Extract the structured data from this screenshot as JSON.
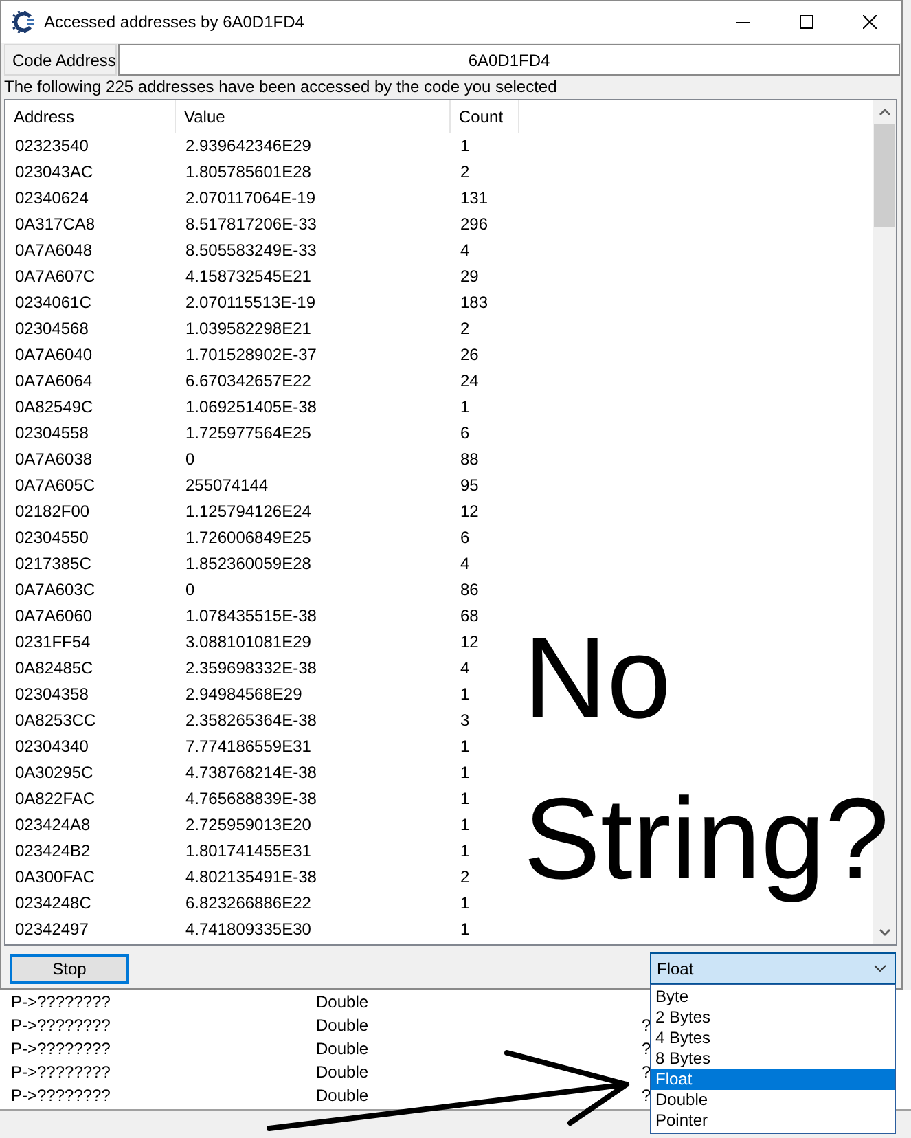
{
  "window": {
    "title": "Accessed addresses by 6A0D1FD4"
  },
  "code_address": {
    "label": "Code Address",
    "value": "6A0D1FD4"
  },
  "info_text": "The following 225 addresses have been accessed by the code you selected",
  "table": {
    "columns": [
      "Address",
      "Value",
      "Count"
    ],
    "rows": [
      [
        "02323540",
        "2.939642346E29",
        "1"
      ],
      [
        "023043AC",
        "1.805785601E28",
        "2"
      ],
      [
        "02340624",
        "2.070117064E-19",
        "131"
      ],
      [
        "0A317CA8",
        "8.517817206E-33",
        "296"
      ],
      [
        "0A7A6048",
        "8.505583249E-33",
        "4"
      ],
      [
        "0A7A607C",
        "4.158732545E21",
        "29"
      ],
      [
        "0234061C",
        "2.070115513E-19",
        "183"
      ],
      [
        "02304568",
        "1.039582298E21",
        "2"
      ],
      [
        "0A7A6040",
        "1.701528902E-37",
        "26"
      ],
      [
        "0A7A6064",
        "6.670342657E22",
        "24"
      ],
      [
        "0A82549C",
        "1.069251405E-38",
        "1"
      ],
      [
        "02304558",
        "1.725977564E25",
        "6"
      ],
      [
        "0A7A6038",
        "0",
        "88"
      ],
      [
        "0A7A605C",
        "255074144",
        "95"
      ],
      [
        "02182F00",
        "1.125794126E24",
        "12"
      ],
      [
        "02304550",
        "1.726006849E25",
        "6"
      ],
      [
        "0217385C",
        "1.852360059E28",
        "4"
      ],
      [
        "0A7A603C",
        "0",
        "86"
      ],
      [
        "0A7A6060",
        "1.078435515E-38",
        "68"
      ],
      [
        "0231FF54",
        "3.088101081E29",
        "12"
      ],
      [
        "0A82485C",
        "2.359698332E-38",
        "4"
      ],
      [
        "02304358",
        "2.94984568E29",
        "1"
      ],
      [
        "0A8253CC",
        "2.358265364E-38",
        "3"
      ],
      [
        "02304340",
        "7.774186559E31",
        "1"
      ],
      [
        "0A30295C",
        "4.738768214E-38",
        "1"
      ],
      [
        "0A822FAC",
        "4.765688839E-38",
        "1"
      ],
      [
        "023424A8",
        "2.725959013E20",
        "1"
      ],
      [
        "023424B2",
        "1.801741455E31",
        "1"
      ],
      [
        "0A300FAC",
        "4.802135491E-38",
        "2"
      ],
      [
        "0234248C",
        "6.823266886E22",
        "1"
      ],
      [
        "02342497",
        "4.741809335E30",
        "1"
      ]
    ]
  },
  "stop_button": {
    "label": "Stop",
    "focused": true
  },
  "type_dropdown": {
    "value": "Float",
    "expanded": true,
    "options": [
      {
        "label": "Byte",
        "selected": false
      },
      {
        "label": "2 Bytes",
        "selected": false
      },
      {
        "label": "4 Bytes",
        "selected": false
      },
      {
        "label": "8 Bytes",
        "selected": false
      },
      {
        "label": "Float",
        "selected": true
      },
      {
        "label": "Double",
        "selected": false
      },
      {
        "label": "Pointer",
        "selected": false
      }
    ]
  },
  "annotation": {
    "text": "No String?"
  },
  "background_list": {
    "rows": [
      [
        "P->????????",
        "Double"
      ],
      [
        "P->????????",
        "Double",
        "?"
      ],
      [
        "P->????????",
        "Double",
        "?"
      ],
      [
        "P->????????",
        "Double",
        "?"
      ],
      [
        "P->????????",
        "Double",
        "?"
      ]
    ]
  }
}
